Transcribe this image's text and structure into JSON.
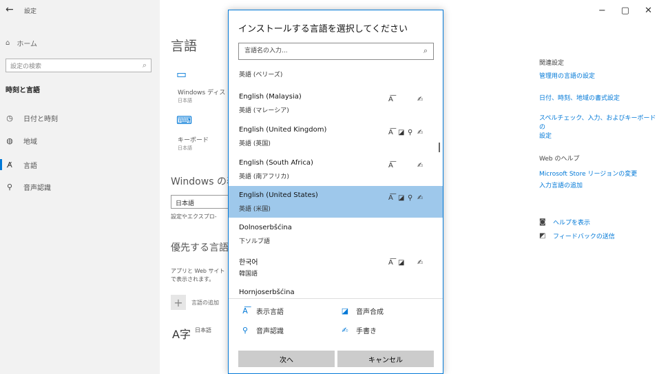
{
  "window": {
    "title": "設定",
    "controls": [
      "−",
      "▢",
      "✕"
    ]
  },
  "sidebar": {
    "home_label": "ホーム",
    "search_placeholder": "設定の検索",
    "section": "時刻と言語",
    "items": [
      {
        "label": "日付と時刻",
        "icon": "calendar-clock-icon"
      },
      {
        "label": "地域",
        "icon": "globe-icon"
      },
      {
        "label": "言語",
        "icon": "language-icon",
        "active": true
      },
      {
        "label": "音声認識",
        "icon": "microphone-icon"
      }
    ]
  },
  "main": {
    "title": "言語",
    "tiles": [
      {
        "label": "Windows ディス",
        "sub": "日本語",
        "icon": "monitor-icon"
      },
      {
        "label": "キーボード",
        "sub": "日本語",
        "icon": "keyboard-icon"
      }
    ],
    "windows_heading": "Windows の表",
    "display_lang_value": "日本語",
    "display_lang_desc": "設定やエクスプロ-",
    "pref_heading": "優先する言語",
    "pref_desc_1": "アプリと Web サイト",
    "pref_desc_2": "で表示されます。",
    "add_lang_label": "言語の追加",
    "japanese_label": "日本語"
  },
  "related": {
    "heading": "関連設定",
    "links": [
      "管理用の言語の設定",
      "日付、時刻、地域の書式設定",
      "スペルチェック、入力、およびキーボードの",
      "設定"
    ],
    "web_help_heading": "Web のヘルプ",
    "web_links": [
      "Microsoft Store リージョンの変更",
      "入力言語の追加"
    ],
    "help_label": "ヘルプを表示",
    "feedback_label": "フィードバックの送信"
  },
  "dialog": {
    "title": "インストールする言語を選択してください",
    "search_placeholder": "言語名の入力...",
    "languages": [
      {
        "name": "",
        "native": "英語 (ベリーズ)",
        "caps": [
          false,
          false,
          false,
          false
        ]
      },
      {
        "name": "English (Malaysia)",
        "native": "英語 (マレーシア)",
        "caps": [
          true,
          false,
          false,
          true
        ]
      },
      {
        "name": "English (United Kingdom)",
        "native": "英語 (英国)",
        "caps": [
          true,
          true,
          true,
          true
        ]
      },
      {
        "name": "English (South Africa)",
        "native": "英語 (南アフリカ)",
        "caps": [
          true,
          false,
          false,
          true
        ]
      },
      {
        "name": "English (United States)",
        "native": "英語 (米国)",
        "caps": [
          true,
          true,
          true,
          true
        ],
        "selected": true
      },
      {
        "name": "Dolnoserbšćina",
        "native": "下ソルブ語",
        "caps": [
          false,
          false,
          false,
          false
        ]
      },
      {
        "name": "한국어",
        "native": "韓国語",
        "caps": [
          true,
          true,
          false,
          true
        ]
      },
      {
        "name": "Hornjoserbšćina",
        "native": "",
        "caps": [
          false,
          false,
          false,
          false
        ]
      }
    ],
    "legend": {
      "display_language": "表示言語",
      "text_to_speech": "音声合成",
      "speech_recognition": "音声認識",
      "handwriting": "手書き"
    },
    "next_button": "次へ",
    "cancel_button": "キャンセル"
  }
}
